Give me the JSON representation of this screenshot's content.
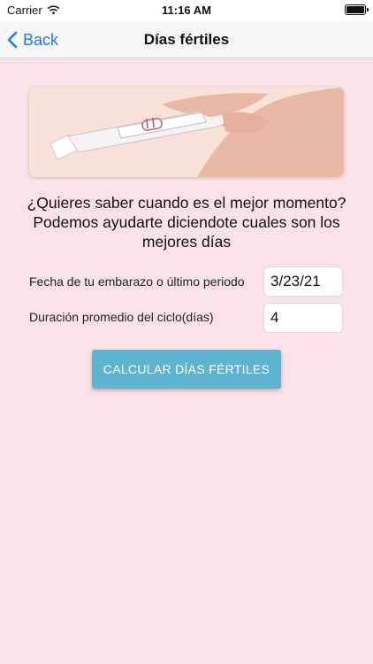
{
  "status_bar": {
    "carrier": "Carrier",
    "time": "11:16 AM"
  },
  "nav": {
    "back_label": "Back",
    "title": "Días fértiles"
  },
  "content": {
    "headline": "¿Quieres saber cuando es el mejor momento? Podemos ayudarte diciendote cuales son los mejores días",
    "fields": [
      {
        "label": "Fecha de tu embarazo o último periodo",
        "value": "3/23/21"
      },
      {
        "label": "Duración promedio del ciclo(días)",
        "value": "4"
      }
    ],
    "button_label": "CALCULAR DÍAS FÉRTILES"
  },
  "colors": {
    "background": "#fbe1e8",
    "accent_button": "#5cb4cf",
    "nav_link": "#1a7bf2"
  },
  "icons": [
    "wifi-icon",
    "battery-icon",
    "back-chevron-icon",
    "pregnancy-test-illustration"
  ]
}
